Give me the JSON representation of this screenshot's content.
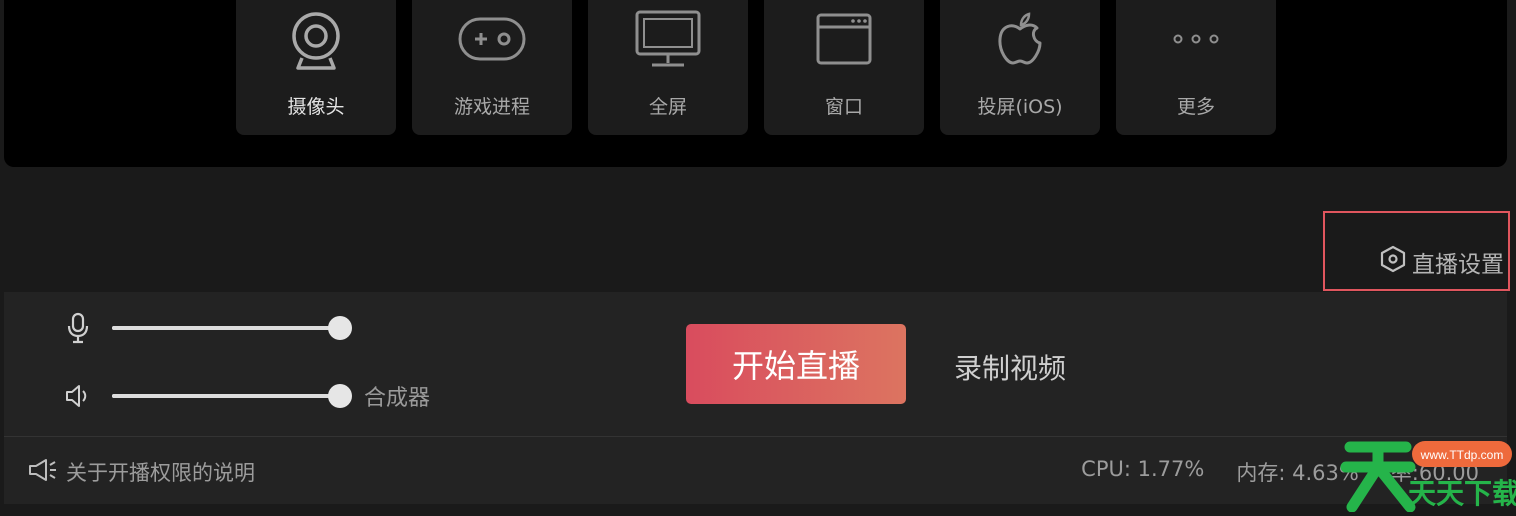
{
  "sources": [
    {
      "id": "camera",
      "label": "摄像头",
      "icon": "webcam-icon",
      "active": true
    },
    {
      "id": "game",
      "label": "游戏进程",
      "icon": "gamepad-icon",
      "active": false
    },
    {
      "id": "fullscreen",
      "label": "全屏",
      "icon": "monitor-icon",
      "active": false
    },
    {
      "id": "window",
      "label": "窗口",
      "icon": "window-icon",
      "active": false
    },
    {
      "id": "ios",
      "label": "投屏(iOS)",
      "icon": "apple-icon",
      "active": false
    },
    {
      "id": "more",
      "label": "更多",
      "icon": "more-dots-icon",
      "active": false
    }
  ],
  "settings": {
    "label": "直播设置",
    "icon": "hexagon-settings-icon",
    "highlight_color": "#e0565e"
  },
  "audio": {
    "mic": {
      "icon": "microphone-icon",
      "level": 1.0
    },
    "speaker": {
      "icon": "speaker-icon",
      "level": 1.0
    },
    "mixer_label": "合成器"
  },
  "actions": {
    "start_label": "开始直播",
    "record_label": "录制视频",
    "accent_start": "#d94c5e",
    "accent_end": "#dc7460"
  },
  "status": {
    "notice": "关于开播权限的说明",
    "notice_icon": "megaphone-icon",
    "cpu": "CPU: 1.77%",
    "memory": "内存: 4.63%",
    "fps": "率:60.00"
  },
  "watermark": {
    "brand": "天天下载",
    "url": "www.TTdp.com"
  }
}
